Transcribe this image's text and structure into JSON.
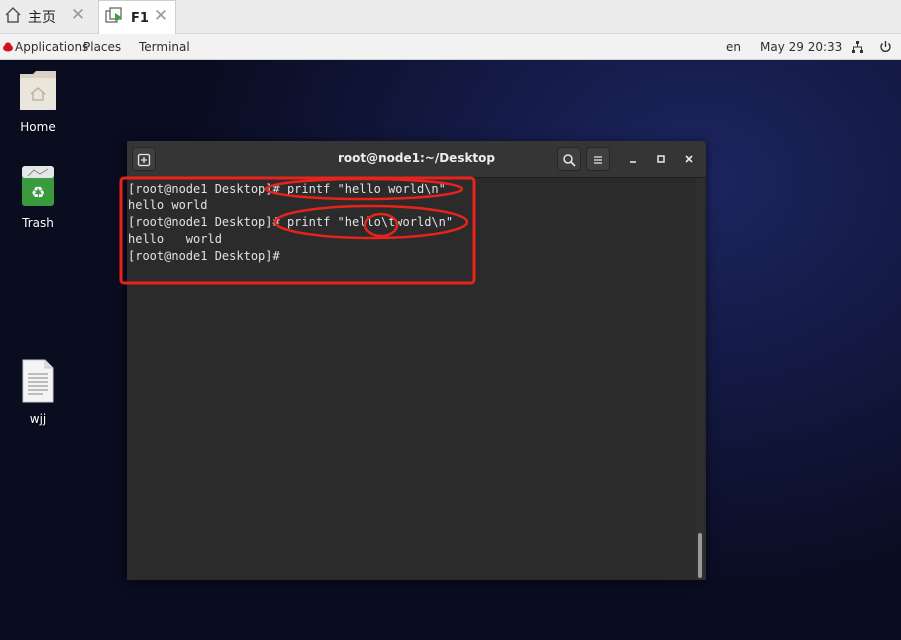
{
  "tabs": [
    {
      "label": "主页",
      "icon": "home-icon"
    },
    {
      "label": "F1",
      "icon": "vm-icon"
    }
  ],
  "panel": {
    "applications": "Applications",
    "places": "Places",
    "terminal": "Terminal",
    "lang": "en",
    "datetime": "May 29  20:33"
  },
  "desktop_icons": [
    {
      "label": "Home"
    },
    {
      "label": "Trash"
    },
    {
      "label": "wjj"
    }
  ],
  "terminal": {
    "title": "root@node1:~/Desktop",
    "lines": [
      "[root@node1 Desktop]# printf \"hello world\\n\"",
      "hello world",
      "[root@node1 Desktop]# printf \"hello\\tworld\\n\"",
      "hello   world",
      "[root@node1 Desktop]#"
    ]
  },
  "annotation_color": "#e8231c"
}
